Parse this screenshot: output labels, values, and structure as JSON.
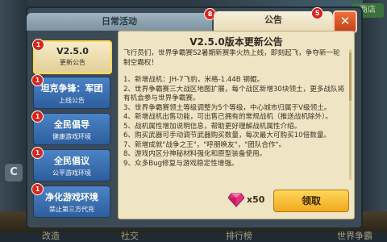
{
  "header": {
    "tabs": [
      {
        "label": "日常活动",
        "badge": "8"
      },
      {
        "label": "公告",
        "badge": "5"
      }
    ],
    "close_label": "✕"
  },
  "background": {
    "shop_label": "商店",
    "c_label": "C",
    "bottom_items": [
      "改造",
      "社交",
      "排行榜",
      "世界争霸"
    ]
  },
  "sidebar": {
    "items": [
      {
        "title": "V2.5.0",
        "subtitle": "更新公告",
        "badge": "1",
        "active": true
      },
      {
        "title": "坦克争锋：军团",
        "subtitle": "上线公告",
        "badge": "1",
        "active": false
      },
      {
        "title": "全民倡导",
        "subtitle": "健康游戏环境",
        "badge": "1",
        "active": false
      },
      {
        "title": "全民倡议",
        "subtitle": "公平游戏环境",
        "badge": "1",
        "active": false
      },
      {
        "title": "净化游戏环境",
        "subtitle": "禁止第三方代充",
        "badge": "1",
        "active": false
      }
    ]
  },
  "notice": {
    "title": "V2.5.0版本更新公告",
    "intro": "飞行员们，世界争霸赛S2暑期新赛季火热上线，即刻起飞，争夺新一轮制空霸权！",
    "items": [
      "1、新增战机：JH-7飞豹，米格-1.44B 钢鲲。",
      "2、世界争霸赛三大战区地图扩展，每个战区新增30块领土，更多战队将有机会参与世界争霸赛。",
      "3、世界争霸赛领土等级调整为5个等级，中心城市归属于V级领土。",
      "4、新增战机出售功能，可出售已拥有的常规战机（推送战机除外）。",
      "5、战机属性增加说明信息，帮助更好理解战机属性介绍。",
      "6、购买武器可手动调节武器购买数量，每次最大可购买10倍数量。",
      "7、新增成就\"战争之王\"，\"呼朋唤友\"，\"团队合作\"。",
      "8、游戏内区分神秘材料强化和原型装备使用。",
      "9、众多Bug修复与游戏稳定性增强。"
    ],
    "reward_count": "x50",
    "claim_label": "领取"
  },
  "colors": {
    "panel": "#3b4a55",
    "content_bg": "#efe4c3",
    "active_tab": "#f6f0dc",
    "sidebar_item": "#2d5e9c",
    "badge": "#d8261d",
    "claim_button": "#f0a91e",
    "close_button": "#d64b22",
    "gem": "#e0337f"
  }
}
